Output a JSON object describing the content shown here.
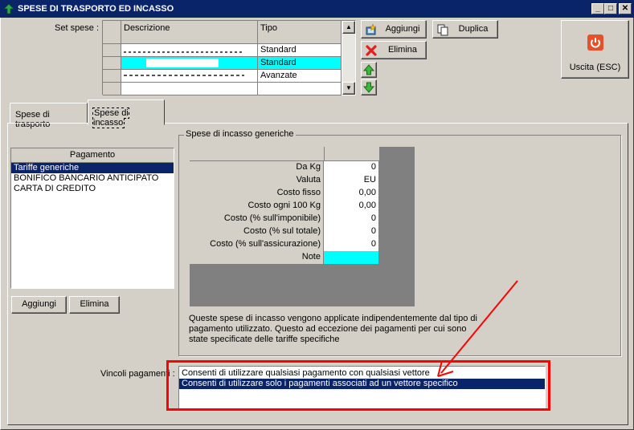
{
  "window": {
    "title": "SPESE DI TRASPORTO ED INCASSO",
    "minimize_glyph": "_",
    "maximize_glyph": "□",
    "close_glyph": "✕"
  },
  "set_spese": {
    "label": "Set spese :",
    "columns": [
      "Descrizione",
      "Tipo"
    ],
    "rows": [
      {
        "descrizione": "",
        "tipo": "Standard"
      },
      {
        "descrizione": "",
        "tipo": "Standard"
      },
      {
        "descrizione": "",
        "tipo": "Avanzate"
      },
      {
        "descrizione": "",
        "tipo": ""
      }
    ],
    "selected_row": 1
  },
  "toolbar": {
    "aggiungi": "Aggiungi",
    "duplica": "Duplica",
    "elimina": "Elimina",
    "exit": "Uscita (ESC)"
  },
  "tabs": [
    "Spese di trasporto",
    "Spese di incasso"
  ],
  "active_tab": 1,
  "pagamento": {
    "header": "Pagamento",
    "items": [
      "Tariffe generiche",
      "BONIFICO BANCARIO ANTICIPATO",
      "CARTA DI CREDITO"
    ],
    "selected": 0,
    "aggiungi": "Aggiungi",
    "elimina": "Elimina"
  },
  "generiche": {
    "group_label": "Spese di incasso generiche",
    "rows": [
      {
        "label": "Da Kg",
        "value": "0"
      },
      {
        "label": "Valuta",
        "value": "EU"
      },
      {
        "label": "Costo fisso",
        "value": "0,00"
      },
      {
        "label": "Costo ogni 100 Kg",
        "value": "0,00"
      },
      {
        "label": "Costo (% sull'imponibile)",
        "value": "0"
      },
      {
        "label": "Costo (% sul totale)",
        "value": "0"
      },
      {
        "label": "Costo (% sull'assicurazione)",
        "value": "0"
      },
      {
        "label": "Note",
        "value": ""
      }
    ],
    "note_line1": "Queste spese di incasso vengono applicate indipendentemente dal tipo di",
    "note_line2": "pagamento utilizzato. Questo ad eccezione dei pagamenti per cui sono",
    "note_line3": "state specificate delle tariffe specifiche"
  },
  "vincoli": {
    "label": "Vincoli pagamenti :",
    "options": [
      "Consenti di utilizzare qualsiasi pagamento con qualsiasi vettore",
      "Consenti di utilizzare solo i pagamenti associati ad un vettore specifico"
    ],
    "selected": 1
  },
  "colors": {
    "titlebar": "#0a246a",
    "selection": "#0a246a",
    "cyan_highlight": "#00ffff",
    "annotation_red": "#ff0000",
    "grid_dark": "#808080"
  }
}
